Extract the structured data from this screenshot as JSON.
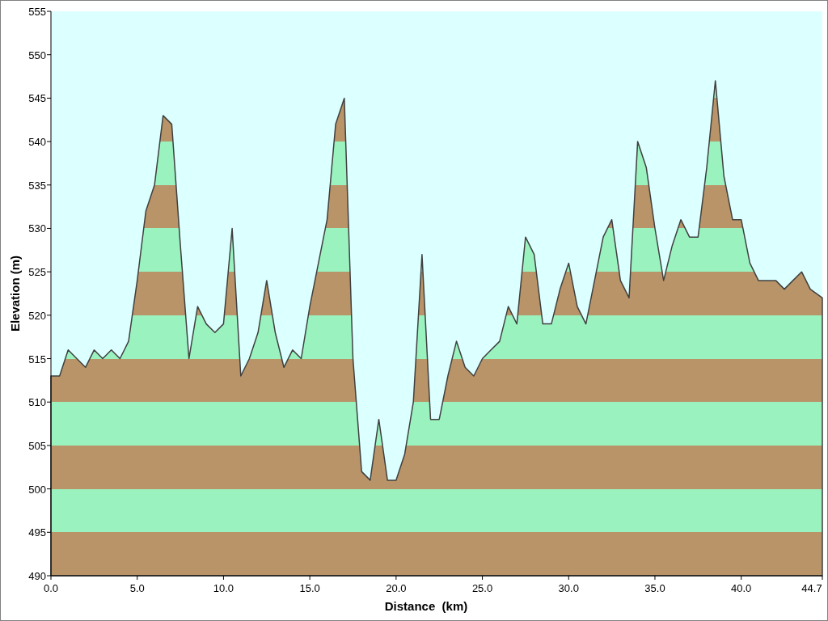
{
  "chart": {
    "chart_data": {
      "type": "area",
      "xlabel": "Distance  (km)",
      "ylabel": "Elevation (m)",
      "x": [
        0,
        0.5,
        1,
        1.5,
        2,
        2.5,
        3,
        3.5,
        4,
        4.5,
        5,
        5.5,
        6,
        6.5,
        7,
        7.5,
        8,
        8.5,
        9,
        9.5,
        10,
        10.5,
        11,
        11.5,
        12,
        12.5,
        13,
        13.5,
        14,
        14.5,
        15,
        15.5,
        16,
        16.5,
        17,
        17.5,
        18,
        18.5,
        19,
        19.5,
        20,
        20.5,
        21,
        21.5,
        22,
        22.5,
        23,
        23.5,
        24,
        24.5,
        25,
        25.5,
        26,
        26.5,
        27,
        27.5,
        28,
        28.5,
        29,
        29.5,
        30,
        30.5,
        31,
        31.5,
        32,
        32.5,
        33,
        33.5,
        34,
        34.5,
        35,
        35.5,
        36,
        36.5,
        37,
        37.5,
        38,
        38.5,
        39,
        39.5,
        40,
        40.5,
        41,
        41.5,
        42,
        42.5,
        43,
        43.5,
        44,
        44.7
      ],
      "series": [
        {
          "color": "#404040",
          "values": [
            513,
            513,
            516,
            515,
            514,
            516,
            515,
            516,
            515,
            517,
            524,
            532,
            535,
            543,
            542,
            528,
            515,
            521,
            519,
            518,
            519,
            530,
            513,
            515,
            518,
            524,
            518,
            514,
            516,
            515,
            521,
            526,
            531,
            542,
            545,
            515,
            502,
            501,
            508,
            501,
            501,
            504,
            510,
            527,
            508,
            508,
            513,
            517,
            514,
            513,
            515,
            516,
            517,
            521,
            519,
            529,
            527,
            519,
            519,
            523,
            526,
            521,
            519,
            524,
            529,
            531,
            524,
            522,
            540,
            537,
            530,
            524,
            528,
            531,
            529,
            529,
            537,
            547,
            536,
            531,
            531,
            526,
            524,
            524,
            524,
            523,
            524,
            525,
            523,
            522
          ]
        }
      ],
      "xlim": [
        0,
        44.7
      ],
      "ylim": [
        490,
        555
      ],
      "xticks": [
        {
          "value": 0,
          "label": "0.0"
        },
        {
          "value": 5,
          "label": "5.0"
        },
        {
          "value": 10,
          "label": "10.0"
        },
        {
          "value": 15,
          "label": "15.0"
        },
        {
          "value": 20,
          "label": "20.0"
        },
        {
          "value": 25,
          "label": "25.0"
        },
        {
          "value": 30,
          "label": "30.0"
        },
        {
          "value": 35,
          "label": "35.0"
        },
        {
          "value": 40,
          "label": "40.0"
        },
        {
          "value": 44.7,
          "label": "44.7"
        }
      ],
      "yticks": [
        490,
        495,
        500,
        505,
        510,
        515,
        520,
        525,
        530,
        535,
        540,
        545,
        550,
        555
      ]
    }
  }
}
